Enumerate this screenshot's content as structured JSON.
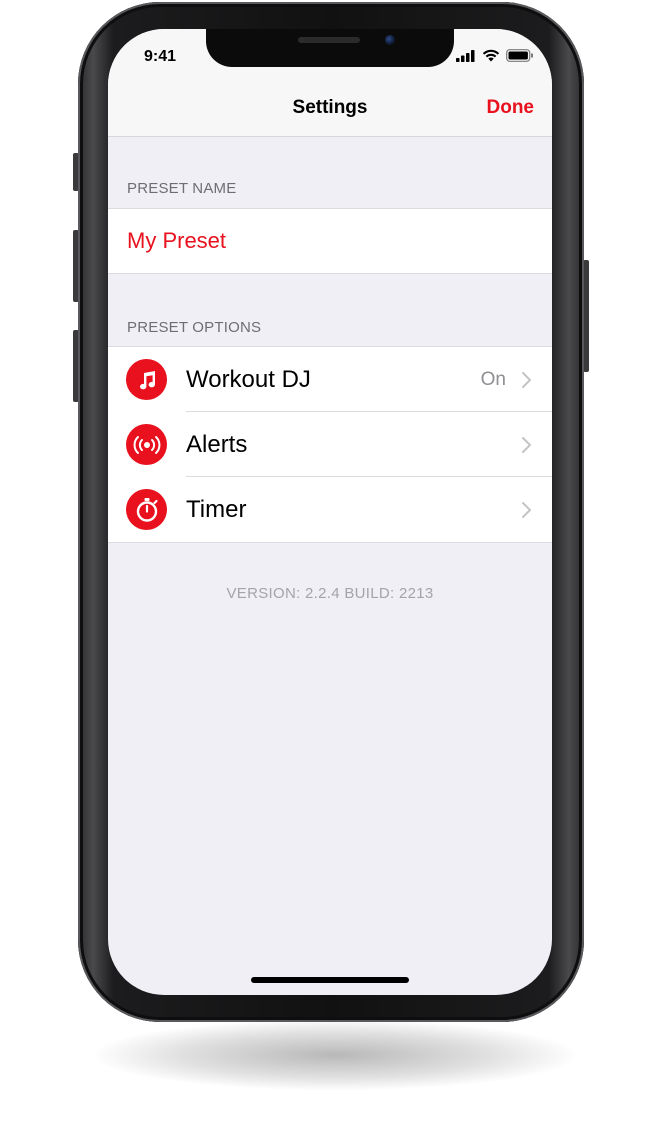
{
  "status_bar": {
    "time": "9:41",
    "icons": [
      "cellular-signal-icon",
      "wifi-icon",
      "battery-icon"
    ]
  },
  "nav": {
    "title": "Settings",
    "done_label": "Done"
  },
  "preset_name_section": {
    "header": "PRESET NAME",
    "value": "My Preset"
  },
  "preset_options_section": {
    "header": "PRESET OPTIONS",
    "items": [
      {
        "label": "Workout DJ",
        "detail": "On",
        "icon": "music-note-icon"
      },
      {
        "label": "Alerts",
        "detail": "",
        "icon": "broadcast-alert-icon"
      },
      {
        "label": "Timer",
        "detail": "",
        "icon": "stopwatch-icon"
      }
    ]
  },
  "footer": {
    "version_text": "VERSION: 2.2.4 BUILD: 2213"
  },
  "colors": {
    "accent": "#e8111d",
    "background": "#f0eff5",
    "secondary_text": "#6d6d72"
  }
}
